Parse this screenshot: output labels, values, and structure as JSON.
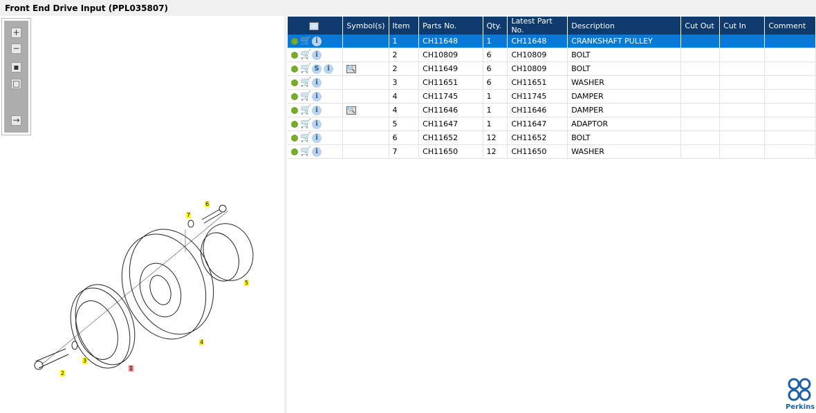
{
  "title": "Front End Drive Input (PPL035807)",
  "toolbar": [
    "zoom-in",
    "zoom-out",
    "fit-all",
    "fit-window",
    "toggle-panel"
  ],
  "columns": [
    "",
    "Symbol(s)",
    "Item",
    "Parts No.",
    "Qty.",
    "Latest Part No.",
    "Description",
    "Cut Out",
    "Cut In",
    "Comment"
  ],
  "rows": [
    {
      "sym": false,
      "s": false,
      "item": "1",
      "part": "CH11648",
      "qty": "1",
      "latest": "CH11648",
      "desc": "CRANKSHAFT PULLEY",
      "selected": true
    },
    {
      "sym": false,
      "s": false,
      "item": "2",
      "part": "CH10809",
      "qty": "6",
      "latest": "CH10809",
      "desc": "BOLT"
    },
    {
      "sym": true,
      "s": true,
      "item": "2",
      "part": "CH11649",
      "qty": "6",
      "latest": "CH10809",
      "desc": "BOLT"
    },
    {
      "sym": false,
      "s": false,
      "item": "3",
      "part": "CH11651",
      "qty": "6",
      "latest": "CH11651",
      "desc": "WASHER"
    },
    {
      "sym": false,
      "s": false,
      "item": "4",
      "part": "CH11745",
      "qty": "1",
      "latest": "CH11745",
      "desc": "DAMPER"
    },
    {
      "sym": true,
      "s": false,
      "item": "4",
      "part": "CH11646",
      "qty": "1",
      "latest": "CH11646",
      "desc": "DAMPER"
    },
    {
      "sym": false,
      "s": false,
      "item": "5",
      "part": "CH11647",
      "qty": "1",
      "latest": "CH11647",
      "desc": "ADAPTOR"
    },
    {
      "sym": false,
      "s": false,
      "item": "6",
      "part": "CH11652",
      "qty": "12",
      "latest": "CH11652",
      "desc": "BOLT"
    },
    {
      "sym": false,
      "s": false,
      "item": "7",
      "part": "CH11650",
      "qty": "12",
      "latest": "CH11650",
      "desc": "WASHER"
    }
  ],
  "callouts": [
    {
      "label": "1",
      "highlight": "#f08080"
    },
    {
      "label": "2",
      "highlight": "#ffff00"
    },
    {
      "label": "3",
      "highlight": "#ffff00"
    },
    {
      "label": "4",
      "highlight": "#ffff00"
    },
    {
      "label": "5",
      "highlight": "#ffff00"
    },
    {
      "label": "6",
      "highlight": "#ffff00"
    },
    {
      "label": "7",
      "highlight": "#ffff00"
    }
  ],
  "logo": "Perkins",
  "colors": {
    "header": "#0e3a6e",
    "selected": "#0a78d7"
  }
}
